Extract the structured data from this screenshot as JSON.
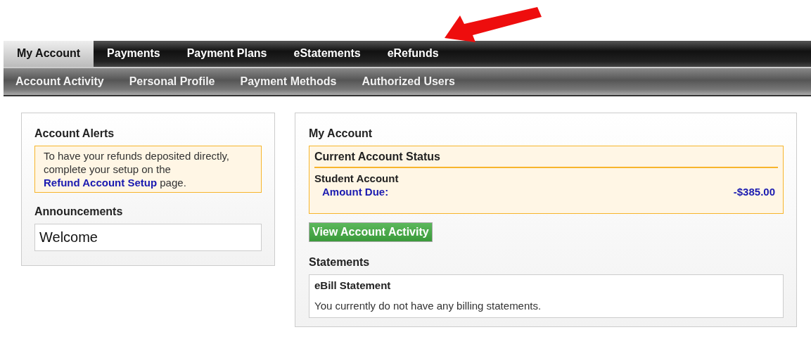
{
  "tabs": [
    {
      "label": "My Account",
      "selected": true
    },
    {
      "label": "Payments",
      "selected": false
    },
    {
      "label": "Payment Plans",
      "selected": false
    },
    {
      "label": "eStatements",
      "selected": false
    },
    {
      "label": "eRefunds",
      "selected": false
    }
  ],
  "subnav": [
    "Account Activity",
    "Personal Profile",
    "Payment Methods",
    "Authorized Users"
  ],
  "left_panel": {
    "alerts_title": "Account Alerts",
    "alert": {
      "text_before": "To have your refunds deposited directly, complete your setup on the",
      "link": "Refund Account Setup",
      "text_after": "page."
    },
    "announcements_title": "Announcements",
    "announcement": "Welcome"
  },
  "right_panel": {
    "title": "My Account",
    "status": {
      "title": "Current Account Status",
      "account": "Student Account",
      "amount_label": "Amount Due:",
      "amount": "-$385.00"
    },
    "button": "View Account Activity",
    "statements_title": "Statements",
    "statement": {
      "title": "eBill Statement",
      "message": "You currently do not have any billing statements."
    }
  }
}
